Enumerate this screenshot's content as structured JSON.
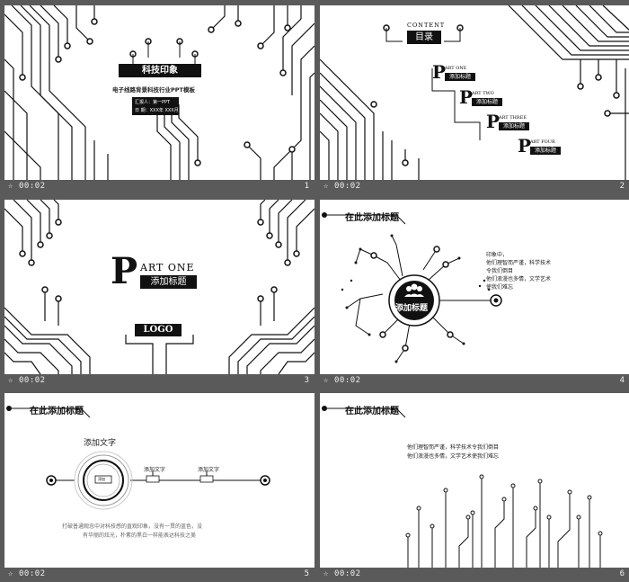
{
  "slides": [
    {
      "number": "1",
      "time": "00:02",
      "title": "科技印象",
      "subtitle": "电子线路背景科技行业PPT模板",
      "meta": [
        "汇报人：第一PPT",
        "日  期：XXX年 XXX月"
      ]
    },
    {
      "number": "2",
      "time": "00:02",
      "content_label": "CONTENT",
      "toc_title": "目录",
      "parts": [
        {
          "part": "ART ONE",
          "label": "添加标题"
        },
        {
          "part": "ART TWO",
          "label": "添加标题"
        },
        {
          "part": "ART THREE",
          "label": "添加标题"
        },
        {
          "part": "ART FOUR",
          "label": "添加标题"
        }
      ]
    },
    {
      "number": "3",
      "time": "00:02",
      "part_big": "ART ONE",
      "part_label": "添加标题",
      "logo": "LOGO"
    },
    {
      "number": "4",
      "time": "00:02",
      "heading": "在此添加标题",
      "center_label": "添加标题",
      "side_text": [
        "印象中，",
        "他们理智而严谨，科学技术",
        "令我们倒目",
        "他们浪漫也多情，文学艺术",
        "使我们难忘"
      ]
    },
    {
      "number": "5",
      "time": "00:02",
      "heading": "在此添加标题",
      "main_label": "添加文字",
      "node_label": "添加",
      "side_labels": [
        "添加文字",
        "添加文字"
      ],
      "body": [
        "打破普通观念中对科技感的直观印象，没有一贯的蓝色，没",
        "有华丽的炫光，朴素的黑白一样能表达科技之美"
      ]
    },
    {
      "number": "6",
      "time": "00:02",
      "heading": "在此添加标题",
      "body": [
        "他们理智而严谨，科学技术令我们倒目",
        "他们浪漫也多情，文学艺术使我们难忘"
      ]
    }
  ]
}
